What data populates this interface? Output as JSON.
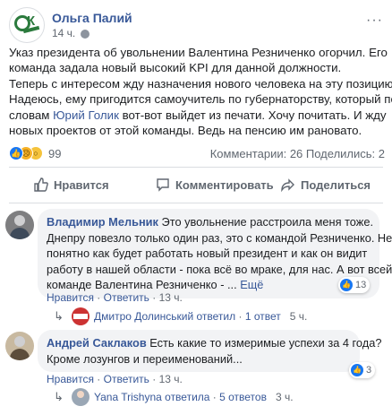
{
  "post": {
    "author": "Ольга Палий",
    "time": "14 ч.",
    "more_glyph": "···",
    "lines": [
      "Указ президента об увольнении Валентина Резниченко огорчил. Его",
      "команда задала новый высокий KPI для данной должности.",
      "Теперь с интересом жду назначения нового человека на эту позицию.",
      "Надеюсь, ему пригодится самоучитель по губернаторству, который по"
    ],
    "line5_before": "словам ",
    "line5_link": "Юрий Голик",
    "line5_after": " вот-вот выйдет из печати. Хочу почитать. И жду",
    "line6": "новых проектов от этой команды. Ведь на пенсию им рановато.",
    "reaction_count": "99",
    "reaction_icons": [
      "like-icon",
      "sad-icon",
      "wow-icon"
    ],
    "stats": "Комментарии: 26  Поделились: 2"
  },
  "actions": {
    "like": "Нравится",
    "comment": "Комментировать",
    "share": "Поделиться"
  },
  "comments": [
    {
      "author": "Владимир Мельник",
      "lines": [
        " Это увольнение расстроила меня тоже.",
        "Днепру повезло только один раз, это с командой Резниченко. Не",
        "понятно как будет работать новый президент и как он видит",
        "работу в нашей области - пока всё во мраке, для нас. А вот всей"
      ],
      "last_line": "команде Валентина Резниченко - ... ",
      "more": "Ещё",
      "like": "Нравится",
      "reply": "Ответить",
      "time": "13 ч.",
      "reactions": "13",
      "reply_summary": {
        "name": "Дмитро Долинський ответил",
        "count": "1 ответ",
        "time": "5 ч."
      }
    },
    {
      "author": "Андрей Саклаков",
      "lines": [
        " Есть какие то измеримые успехи за 4 года?",
        "Кроме лозунгов и переименований..."
      ],
      "like": "Нравится",
      "reply": "Ответить",
      "time": "13 ч.",
      "reactions": "3",
      "reply_summary": {
        "name": "Yana Trishyna ответила",
        "count": "5 ответов",
        "time": "3 ч."
      }
    }
  ],
  "colors": {
    "link": "#385898",
    "muted": "#606770",
    "bubble": "#f2f3f5",
    "like_blue": "#1877f2"
  }
}
